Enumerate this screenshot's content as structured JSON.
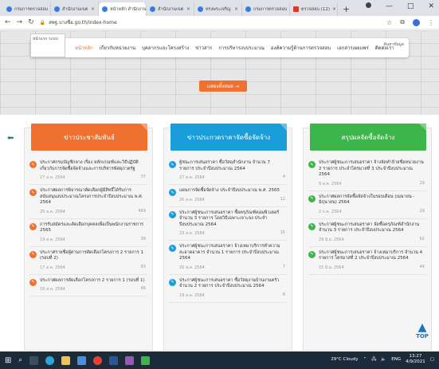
{
  "browser": {
    "tabs": [
      {
        "label": "กรมการตรวจสอบ",
        "active": false
      },
      {
        "label": "สำนักงานเขต",
        "active": false
      },
      {
        "label": "หน้าหลัก สำนักงาน",
        "active": true
      },
      {
        "label": "สำนักงานเขต",
        "active": false
      },
      {
        "label": "ทรงพระเจริญ",
        "active": false
      },
      {
        "label": "กรมการตรวจสอบ",
        "active": false
      },
      {
        "label": "ตรวจสอบ (12)",
        "active": false
      }
    ],
    "url": "สพฐ.บางซื่อ.go.th/index-home",
    "window_controls": [
      "—",
      "□",
      "✕"
    ]
  },
  "site": {
    "logo_text": "หน้าแรก ระบบ",
    "menu": [
      {
        "label": "หน้าหลัก",
        "active": true
      },
      {
        "label": "เกี่ยวกับหน่วยงาน",
        "active": false
      },
      {
        "label": "บุคลากรและโครงสร้าง",
        "active": false
      },
      {
        "label": "ข่าวสาร",
        "active": false
      },
      {
        "label": "การบริหารงบประมาณ",
        "active": false
      },
      {
        "label": "องค์ความรู้ด้านการตรวจสอบ",
        "active": false
      },
      {
        "label": "เอกสารเผยแพร่",
        "active": false
      },
      {
        "label": "ติดต่อเรา",
        "active": false
      }
    ],
    "menu_right": "ค้นหาข้อมูล",
    "cta_label": "แสดงทั้งหมด →"
  },
  "columns": [
    {
      "title": "ข่าวประชาสัมพันธ์",
      "color": "#f0712f",
      "items": [
        {
          "text": "ประกาศกรมบัญชีกลาง เรื่อง หลักเกณฑ์และวิธีปฏิบัติเกี่ยวกับการจัดซื้อจัดจ้างและการบริหารพัสดุภาครัฐ",
          "date": "27 ส.ค. 2564",
          "count": "37"
        },
        {
          "text": "ประกาศผลการพิจารณาคัดเลือกผู้มีสิทธิ์ได้รับการสนับสนุนงบประมาณโครงการประจำปีงบประมาณ พ.ศ. 2564",
          "date": "25 ส.ค. 2564",
          "count": "489"
        },
        {
          "text": "การรับสมัครและคัดเลือกบุคคลเพื่อเป็นพนักงานราชการ 2565",
          "date": "19 ส.ค. 2564",
          "count": "39"
        },
        {
          "text": "ประกาศรายชื่อผู้ผ่านการคัดเลือกโครงการ 2 รายการ 1 (รอบที่ 2)",
          "date": "17 ส.ค. 2564",
          "count": "83"
        },
        {
          "text": "ประกาศผลการคัดเลือกโครงการ 2 รายการ 1 (รอบที่ 1)",
          "date": "16 ส.ค. 2564",
          "count": "46"
        }
      ]
    },
    {
      "title": "ข่าวประกวดราคาจัดซื้อจัดจ้าง",
      "color": "#1a9ed9",
      "items": [
        {
          "text": "ผู้ชนะการเสนอราคา ซื้อวัสดุสำนักงาน จำนวน 7 รายการ ประจำปีงบประมาณ 2564",
          "date": "27 ส.ค. 2564",
          "count": "4"
        },
        {
          "text": "แผนการจัดซื้อจัดจ้าง ประจำปีงบประมาณ พ.ศ. 2565",
          "date": "26 ส.ค. 2564",
          "count": "12"
        },
        {
          "text": "ประกาศผู้ชนะการเสนอราคา ซื้อครุภัณฑ์คอมพิวเตอร์ จำนวน 3 รายการ โดยวิธีเฉพาะเจาะจง ประจำปีงบประมาณ 2564",
          "date": "23 ส.ค. 2564",
          "count": "15"
        },
        {
          "text": "ประกาศผู้ชนะการเสนอราคา จ้างเหมาบริการทำความสะอาดอาคาร จำนวน 1 รายการ ประจำปีงบประมาณ 2564",
          "date": "20 ส.ค. 2564",
          "count": "7"
        },
        {
          "text": "ประกาศผู้ชนะการเสนอราคา ซื้อวัสดุงานบ้านงานครัว จำนวน 2 รายการ ประจำปีงบประมาณ 2564",
          "date": "19 ส.ค. 2564",
          "count": "8"
        }
      ]
    },
    {
      "title": "สรุปผลจัดซื้อจัดจ้าง",
      "color": "#3cb54a",
      "items": [
        {
          "text": "ประกาศผู้ชนะการเสนอราคา จ้างจัดทำป้ายชื่อหน่วยงาน 2 รายการ ประจำไตรมาสที่ 3 ประจำปีงบประมาณ 2564",
          "date": "9 ส.ค. 2564",
          "count": "29"
        },
        {
          "text": "ประกาศผลการจัดซื้อจัดจ้างในรอบเดือน (เมษายน - มิถุนายน) 2564",
          "date": "2 ก.ค. 2564",
          "count": "29"
        },
        {
          "text": "ประกาศผู้ชนะการเสนอราคา จัดซื้อครุภัณฑ์สำนักงาน จำนวน 3 รายการ ประจำปีงบประมาณ 2564",
          "date": "29 มิ.ย. 2564",
          "count": "62"
        },
        {
          "text": "ประกาศผู้ชนะการเสนอราคา จ้างเหมาบริการ จำนวน 4 รายการ ไตรมาสที่ 2 ประจำปีงบประมาณ 2564",
          "date": "15 มิ.ย. 2564",
          "count": "44"
        }
      ]
    }
  ],
  "totop_label": "TOP",
  "taskbar": {
    "weather": "29°C Cloudy",
    "lang": "ENG",
    "time": "13:27",
    "date": "4/9/2021"
  }
}
